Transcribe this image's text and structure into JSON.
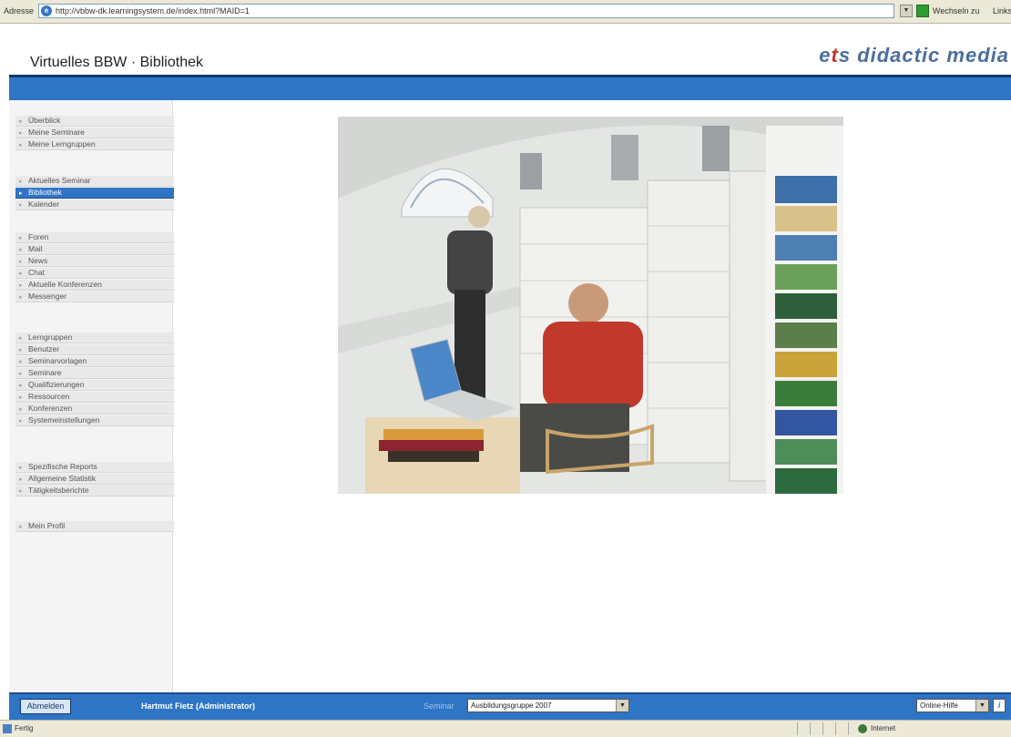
{
  "browser": {
    "address_label": "Adresse",
    "url": "http://vbbw-dk.learningsystem.de/index.html?MAID=1",
    "go_label": "Wechseln zu",
    "links_label": "Links"
  },
  "header": {
    "app_title": "Virtuelles BBW · Bibliothek",
    "brand_prefix": "e",
    "brand_mid": "t",
    "brand_suffix": "s didactic media"
  },
  "sidebar": {
    "groups": [
      [
        "Überblick",
        "Meine Seminare",
        "Meine Lerngruppen"
      ],
      [
        "Aktuelles Seminar",
        "Bibliothek",
        "Kalender"
      ],
      [
        "Foren",
        "Mail",
        "News",
        "Chat",
        "Aktuelle Konferenzen",
        "Messenger"
      ],
      [
        "Lerngruppen",
        "Benutzer",
        "Seminarvorlagen",
        "Seminare",
        "Qualifizierungen",
        "Ressourcen",
        "Konferenzen",
        "Systemeinstellungen"
      ],
      [
        "Spezifische Reports",
        "Allgemeine Statistik",
        "Tätigkeitsberichte"
      ],
      [
        "Mein Profil"
      ]
    ],
    "active_item": "Bibliothek"
  },
  "footer": {
    "logout_label": "Abmelden",
    "user_name": "Hartmut Fietz (Administrator)",
    "seminar_label": "Seminar",
    "seminar_value": "Ausbildungsgruppe 2007",
    "help_value": "Online-Hilfe",
    "info_label": "i"
  },
  "statusbar": {
    "status_text": "Fertig",
    "zone_text": "Internet"
  },
  "colors": {
    "accent_blue": "#2f75c6",
    "brand_blue": "#4a6fa0",
    "brand_red": "#c8362b"
  }
}
